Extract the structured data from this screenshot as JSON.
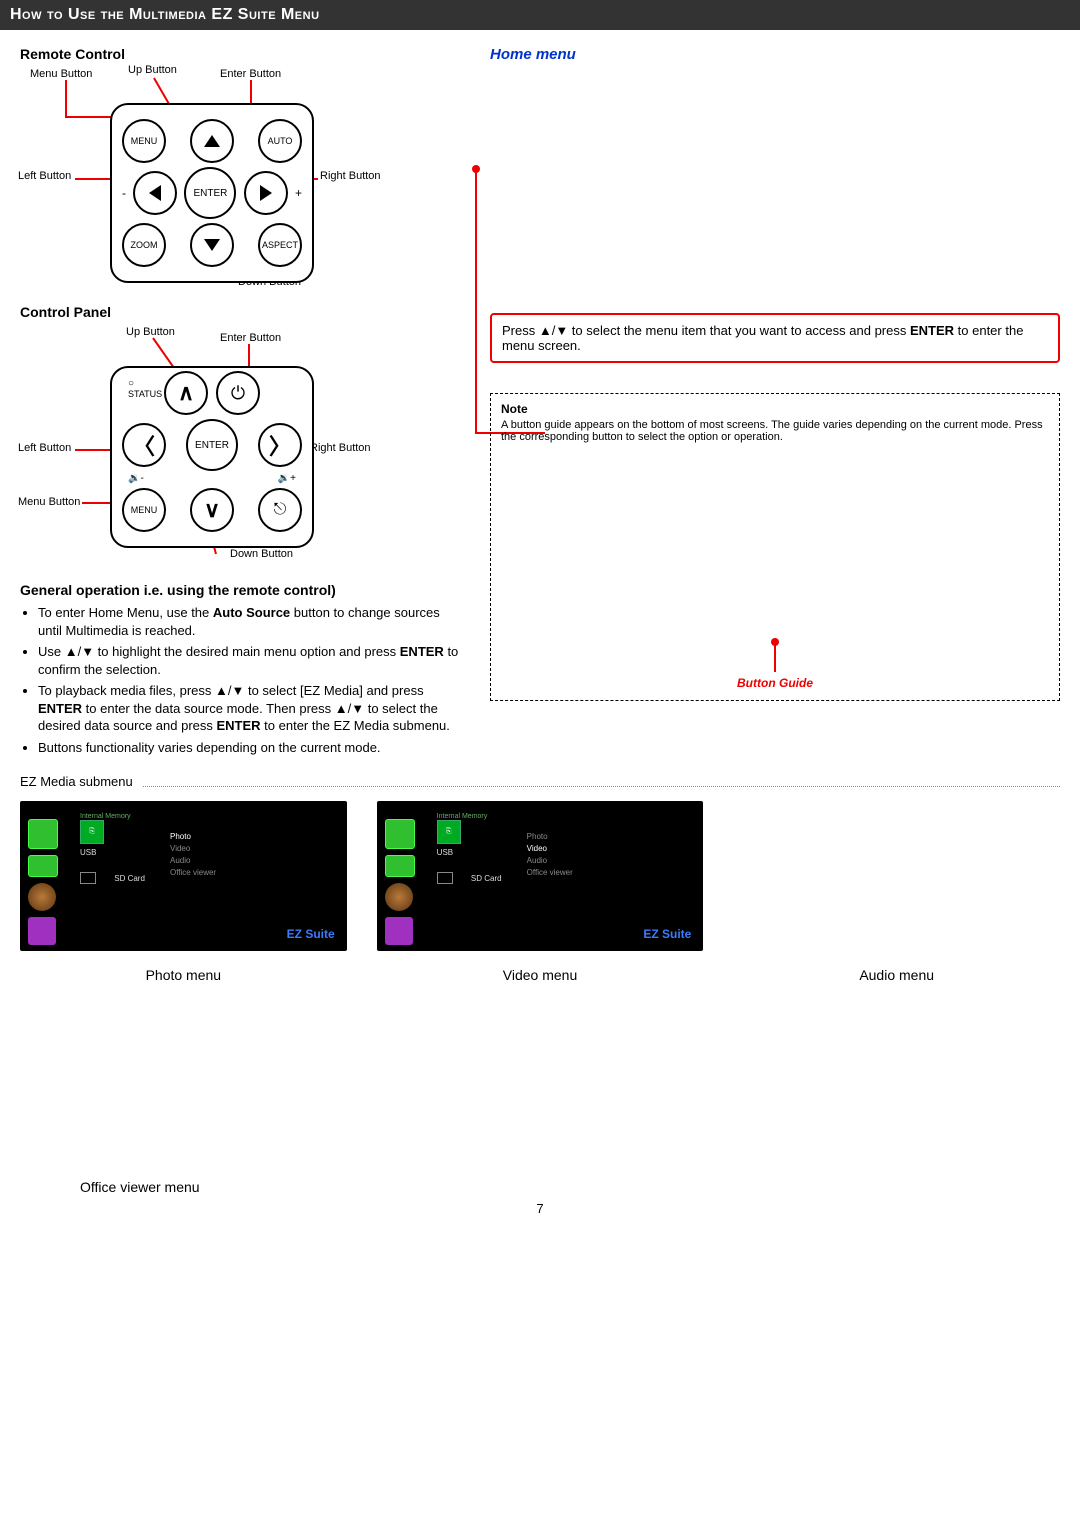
{
  "header": "How to Use the Multimedia EZ Suite Menu",
  "sections": {
    "remote_control_heading": "Remote Control",
    "control_panel_heading": "Control Panel",
    "general_operation_heading": "General operation i.e. using the remote control)",
    "home_menu_heading": "Home menu"
  },
  "remote": {
    "labels": {
      "menu_button": "Menu Button",
      "up_button": "Up Button",
      "enter_button": "Enter Button",
      "left_button": "Left Button",
      "right_button": "Right Button",
      "down_button": "Down Button"
    },
    "buttons": {
      "menu": "MENU",
      "auto": "AUTO",
      "enter": "ENTER",
      "zoom": "ZOOM",
      "aspect": "ASPECT"
    }
  },
  "panel": {
    "labels": {
      "up_button": "Up Button",
      "enter_button": "Enter Button",
      "left_button": "Left Button",
      "right_button": "Right Button",
      "menu_button": "Menu Button",
      "down_button": "Down Button"
    },
    "status": "STATUS",
    "enter": "ENTER",
    "menu": "MENU"
  },
  "general_operation": {
    "items": [
      {
        "pre": "To enter Home Menu, use the ",
        "bold": "Auto Source",
        "post": " button to change sources until Multimedia is reached."
      },
      {
        "pre": "Use ▲/▼ to highlight the desired main menu option and press ",
        "bold": "ENTER",
        "post": " to confirm the selection."
      },
      {
        "pre": "To playback media files, press ▲/▼ to select [EZ Media] and press ",
        "bold": "ENTER",
        "mid": " to enter the data source mode. Then press ▲/▼ to select the desired data source and press ",
        "bold2": "ENTER",
        "post": " to enter the EZ Media submenu."
      },
      {
        "pre": "Buttons functionality varies depending on the current mode.",
        "bold": "",
        "post": ""
      }
    ]
  },
  "tip": {
    "pre": "Press ▲/▼ to select the menu item that you want to access and press ",
    "bold": "ENTER",
    "post": " to enter the menu screen."
  },
  "note": {
    "title": "Note",
    "body": "A button guide appears on the bottom of most screens. The guide varies depending on the current mode. Press the corresponding button to select the option or operation.",
    "button_guide": "Button Guide"
  },
  "submenu_label": "EZ Media submenu",
  "thumbs": {
    "photo": {
      "caption": "Photo menu",
      "brand": "EZ Suite",
      "list": [
        "Photo",
        "Video",
        "Audio",
        "Office viewer"
      ],
      "selected_index": 0,
      "devices": [
        "USB",
        "SD Card"
      ],
      "top": "Internal Memory"
    },
    "video": {
      "caption": "Video menu",
      "brand": "EZ Suite",
      "list": [
        "Photo",
        "Video",
        "Audio",
        "Office viewer"
      ],
      "selected_index": 1,
      "devices": [
        "USB",
        "SD Card"
      ],
      "top": "Internal Memory"
    },
    "audio": {
      "caption": "Audio menu"
    },
    "office": {
      "caption": "Office viewer menu"
    }
  },
  "page_number": "7"
}
